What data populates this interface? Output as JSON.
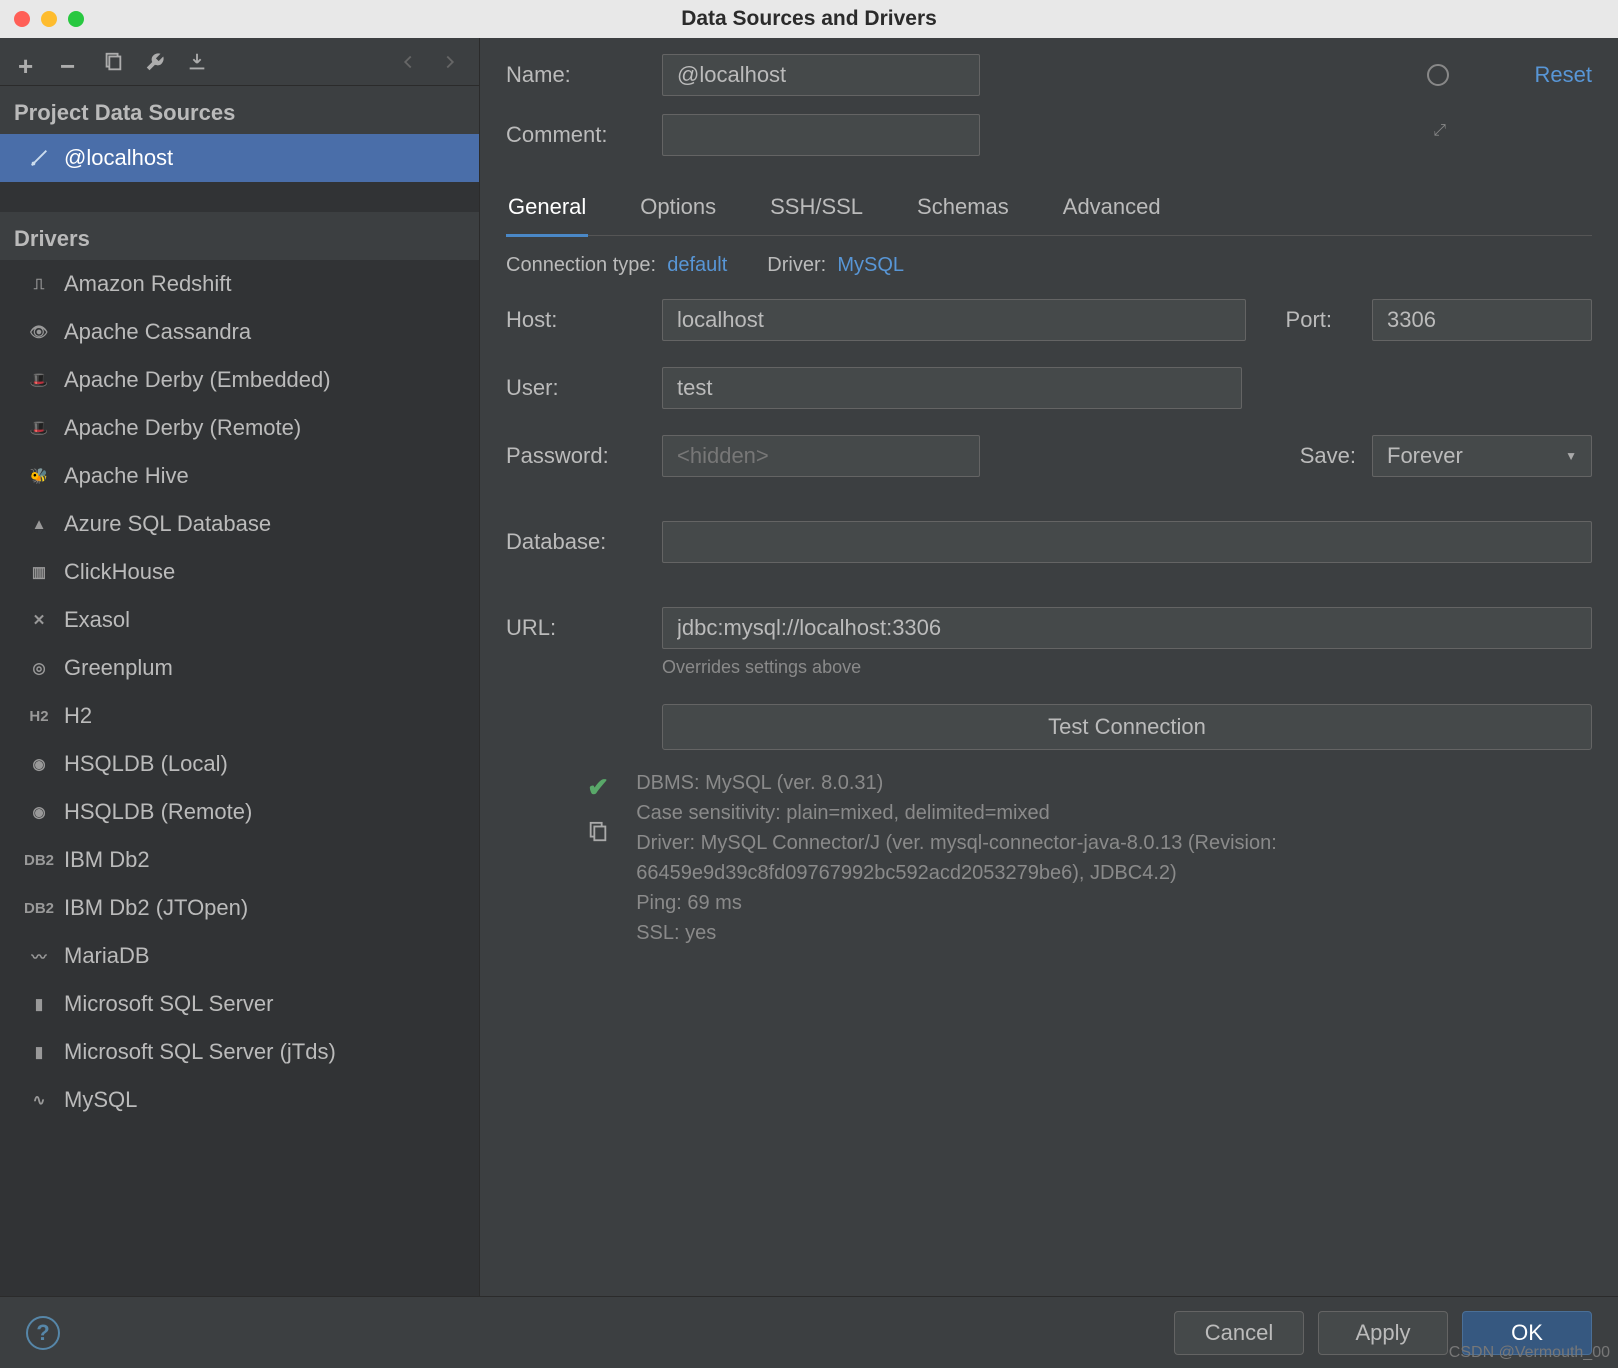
{
  "window_title": "Data Sources and Drivers",
  "toolbar": {
    "add": "+",
    "remove": "−"
  },
  "sidebar": {
    "sections": [
      {
        "title": "Project Data Sources",
        "items": [
          {
            "label": "@localhost",
            "selected": true,
            "icon": "db"
          }
        ]
      },
      {
        "title": "Drivers",
        "items": [
          {
            "label": "Amazon Redshift",
            "icon": "redshift"
          },
          {
            "label": "Apache Cassandra",
            "icon": "cassandra"
          },
          {
            "label": "Apache Derby (Embedded)",
            "icon": "derby"
          },
          {
            "label": "Apache Derby (Remote)",
            "icon": "derby"
          },
          {
            "label": "Apache Hive",
            "icon": "hive"
          },
          {
            "label": "Azure SQL Database",
            "icon": "azure"
          },
          {
            "label": "ClickHouse",
            "icon": "clickhouse"
          },
          {
            "label": "Exasol",
            "icon": "exasol"
          },
          {
            "label": "Greenplum",
            "icon": "greenplum"
          },
          {
            "label": "H2",
            "icon": "h2"
          },
          {
            "label": "HSQLDB (Local)",
            "icon": "hsqldb"
          },
          {
            "label": "HSQLDB (Remote)",
            "icon": "hsqldb"
          },
          {
            "label": "IBM Db2",
            "icon": "db2"
          },
          {
            "label": "IBM Db2 (JTOpen)",
            "icon": "db2"
          },
          {
            "label": "MariaDB",
            "icon": "mariadb"
          },
          {
            "label": "Microsoft SQL Server",
            "icon": "mssql"
          },
          {
            "label": "Microsoft SQL Server (jTds)",
            "icon": "mssql"
          },
          {
            "label": "MySQL",
            "icon": "mysql"
          }
        ]
      }
    ]
  },
  "form": {
    "name_label": "Name:",
    "name_value": "@localhost",
    "comment_label": "Comment:",
    "comment_value": "",
    "reset": "Reset"
  },
  "tabs": [
    {
      "label": "General",
      "active": true
    },
    {
      "label": "Options"
    },
    {
      "label": "SSH/SSL"
    },
    {
      "label": "Schemas"
    },
    {
      "label": "Advanced"
    }
  ],
  "conn": {
    "type_label": "Connection type:",
    "type_value": "default",
    "driver_label": "Driver:",
    "driver_value": "MySQL"
  },
  "fields": {
    "host_label": "Host:",
    "host_value": "localhost",
    "port_label": "Port:",
    "port_value": "3306",
    "user_label": "User:",
    "user_value": "test",
    "password_label": "Password:",
    "password_placeholder": "<hidden>",
    "save_label": "Save:",
    "save_value": "Forever",
    "database_label": "Database:",
    "database_value": "",
    "url_label": "URL:",
    "url_value": "jdbc:mysql://localhost:3306",
    "url_hint": "Overrides settings above",
    "test_btn": "Test Connection"
  },
  "result": {
    "line1": "DBMS: MySQL (ver. 8.0.31)",
    "line2": "Case sensitivity: plain=mixed, delimited=mixed",
    "line3": "Driver: MySQL Connector/J (ver. mysql-connector-java-8.0.13 (Revision: 66459e9d39c8fd09767992bc592acd2053279be6), JDBC4.2)",
    "line4": "Ping: 69 ms",
    "line5": "SSL: yes"
  },
  "footer": {
    "cancel": "Cancel",
    "apply": "Apply",
    "ok": "OK"
  },
  "watermark": "CSDN @Vermouth_00"
}
